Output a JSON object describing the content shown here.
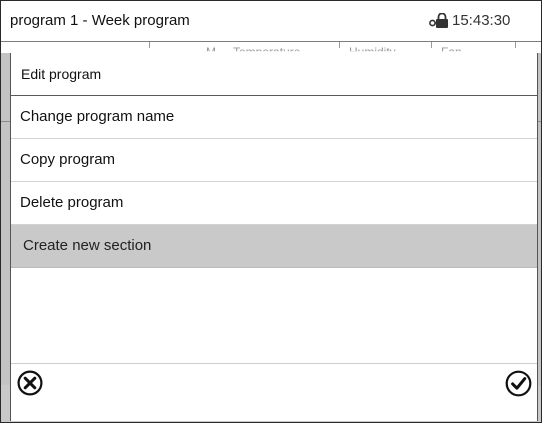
{
  "header": {
    "title": "program 1 - Week program",
    "time": "15:43:30",
    "lock_icon": "lock-key-icon",
    "background_columns": [
      "M",
      "Temperature",
      "Humidity",
      "Fan"
    ]
  },
  "dialog": {
    "title": "Edit program",
    "items": [
      {
        "label": "Change program name",
        "selected": false
      },
      {
        "label": "Copy program",
        "selected": false
      },
      {
        "label": "Delete program",
        "selected": false
      },
      {
        "label": "Create new section",
        "selected": true
      }
    ],
    "cancel_icon": "circle-x-icon",
    "confirm_icon": "circle-check-icon"
  },
  "colors": {
    "selected_row": "#c9c9c9",
    "background_panel": "#c3c3c3",
    "text": "#111111"
  }
}
